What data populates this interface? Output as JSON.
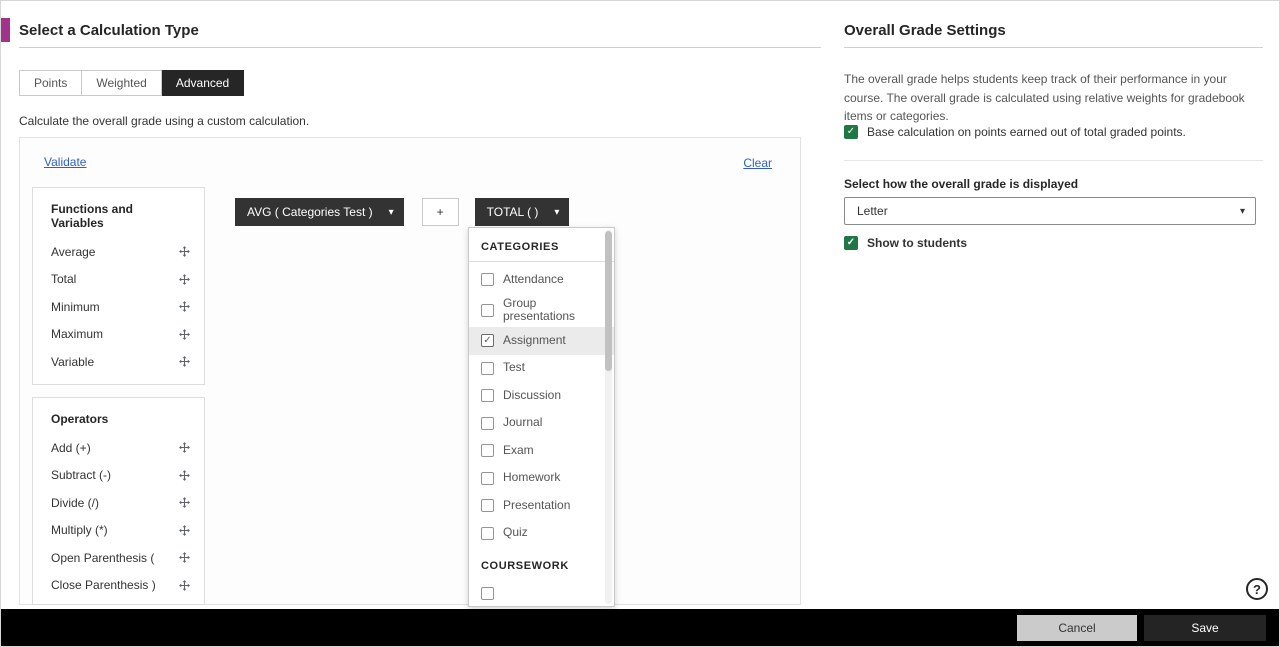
{
  "colors": {
    "accent_purple": "#a2338c",
    "checkbox_green": "#217645",
    "link_blue": "#2f5fca",
    "chip_dark": "#333333",
    "tab_active": "#262626",
    "footer_bar": "#000000"
  },
  "left": {
    "title": "Select a Calculation Type",
    "tabs": [
      {
        "label": "Points",
        "active": false
      },
      {
        "label": "Weighted",
        "active": false
      },
      {
        "label": "Advanced",
        "active": true
      }
    ],
    "description": "Calculate the overall grade using a custom calculation.",
    "validate_label": "Validate",
    "clear_label": "Clear",
    "functions_panel": {
      "title": "Functions and Variables",
      "items": [
        "Average",
        "Total",
        "Minimum",
        "Maximum",
        "Variable"
      ]
    },
    "operators_panel": {
      "title": "Operators",
      "items": [
        "Add (+)",
        "Subtract (-)",
        "Divide (/)",
        "Multiply (*)",
        "Open Parenthesis (",
        "Close Parenthesis )"
      ]
    },
    "expression": {
      "chips": [
        {
          "label": "AVG ( Categories Test )"
        },
        {
          "label": "+"
        },
        {
          "label": "TOTAL ( )"
        }
      ]
    },
    "dropdown": {
      "sections": [
        {
          "header": "CATEGORIES",
          "items": [
            {
              "label": "Attendance",
              "checked": false
            },
            {
              "label": "Group presentations",
              "checked": false
            },
            {
              "label": "Assignment",
              "checked": true
            },
            {
              "label": "Test",
              "checked": false
            },
            {
              "label": "Discussion",
              "checked": false
            },
            {
              "label": "Journal",
              "checked": false
            },
            {
              "label": "Exam",
              "checked": false
            },
            {
              "label": "Homework",
              "checked": false
            },
            {
              "label": "Presentation",
              "checked": false
            },
            {
              "label": "Quiz",
              "checked": false
            }
          ]
        },
        {
          "header": "COURSEWORK",
          "items": [
            {
              "label": "",
              "checked": false
            }
          ]
        }
      ]
    }
  },
  "right": {
    "title": "Overall Grade Settings",
    "description": "The overall grade helps students keep track of their performance in your course. The overall grade is calculated using relative weights for gradebook items or categories.",
    "base_calc_label": "Base calculation on points earned out of total graded points.",
    "base_calc_checked": true,
    "display_label": "Select how the overall grade is displayed",
    "display_value": "Letter",
    "show_students_label": "Show to students",
    "show_students_checked": true
  },
  "footer": {
    "cancel_label": "Cancel",
    "save_label": "Save"
  },
  "help": {
    "label": "?"
  }
}
